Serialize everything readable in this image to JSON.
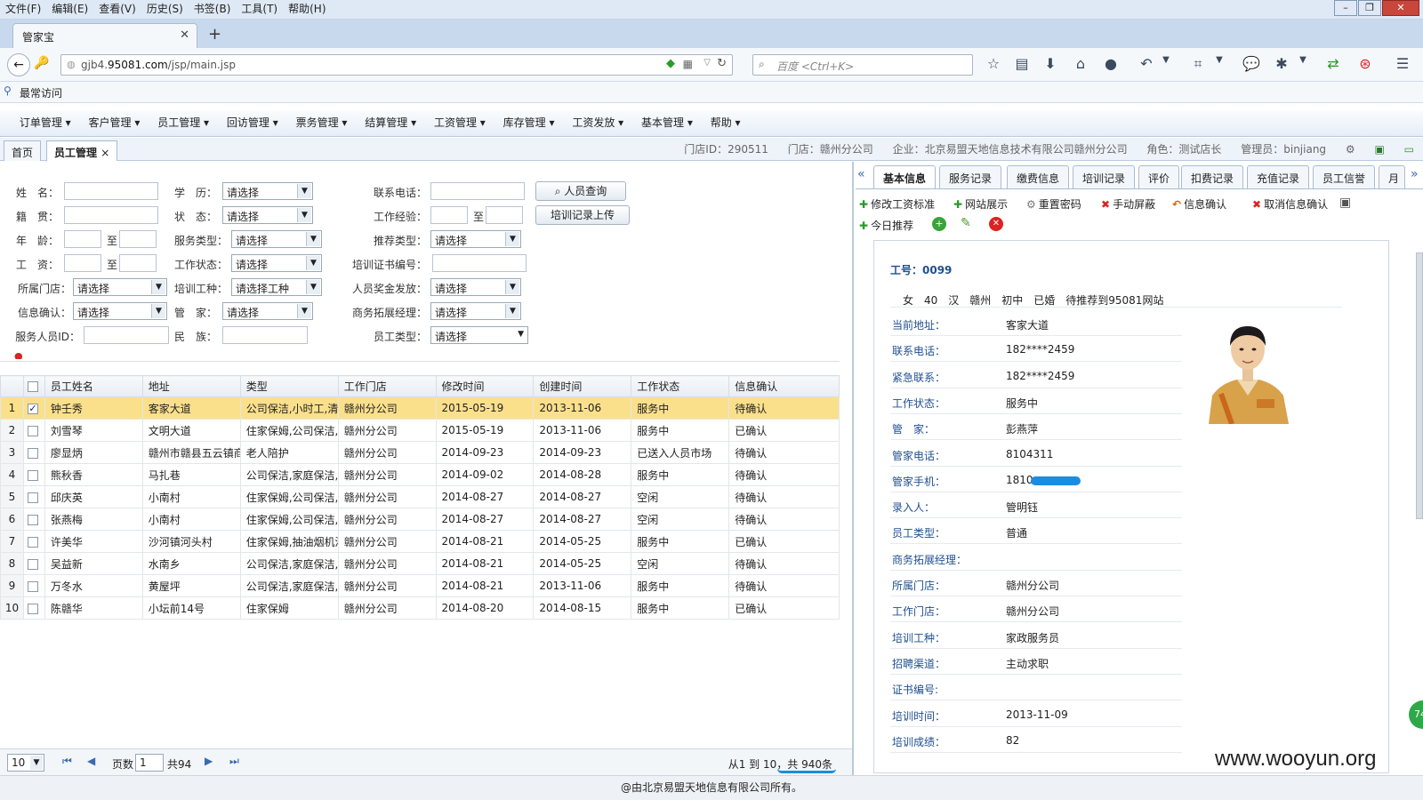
{
  "browser": {
    "menu": [
      "文件(F)",
      "编辑(E)",
      "查看(V)",
      "历史(S)",
      "书签(B)",
      "工具(T)",
      "帮助(H)"
    ],
    "tab_title": "管家宝",
    "url_prefix": "gjb4.",
    "url_domain": "95081.com",
    "url_path": "/jsp/main.jsp",
    "search_placeholder": "百度 <Ctrl+K>",
    "bookmark": "最常访问"
  },
  "app": {
    "menu": [
      "订单管理",
      "客户管理",
      "员工管理",
      "回访管理",
      "票务管理",
      "结算管理",
      "工资管理",
      "库存管理",
      "工资发放",
      "基本管理",
      "帮助"
    ],
    "tabs": [
      "首页",
      "员工管理"
    ],
    "info": {
      "store_id": "门店ID：290511",
      "store": "门店：赣州分公司",
      "company": "企业：北京易盟天地信息技术有限公司赣州分公司",
      "role": "角色：测试店长",
      "admin": "管理员：binjiang"
    }
  },
  "form": {
    "name": "姓　名：",
    "origin": "籍　贯：",
    "age": "年　龄：",
    "wage": "工　资：",
    "store": "所属门店：",
    "confirm": "信息确认：",
    "staff_id": "服务人员ID：",
    "edu": "学　历：",
    "status": "状　态：",
    "service_type": "服务类型：",
    "work_status": "工作状态：",
    "train_type": "培训工种：",
    "butler": "管　家：",
    "ethnic": "民　族：",
    "phone": "联系电话：",
    "experience": "工作经验：",
    "recommend": "推荐类型：",
    "cert_no": "培训证书编号：",
    "bonus": "人员奖金发放：",
    "biz_mgr": "商务拓展经理：",
    "emp_type": "员工类型：",
    "to": "至",
    "please_select": "请选择",
    "select_train": "请选择工种",
    "search_btn": "人员查询",
    "upload_btn": "培训记录上传"
  },
  "grid": {
    "columns": [
      "员工姓名",
      "地址",
      "类型",
      "工作门店",
      "修改时间",
      "创建时间",
      "工作状态",
      "信息确认"
    ],
    "rows": [
      {
        "no": "1",
        "name": "钟壬秀",
        "addr": "客家大道",
        "type": "公司保洁,小时工,清",
        "store": "赣州分公司",
        "mod": "2015-05-19",
        "created": "2013-11-06",
        "status": "服务中",
        "confirm": "待确认"
      },
      {
        "no": "2",
        "name": "刘雪琴",
        "addr": "文明大道",
        "type": "住家保姆,公司保洁,",
        "store": "赣州分公司",
        "mod": "2015-05-19",
        "created": "2013-11-06",
        "status": "服务中",
        "confirm": "已确认"
      },
      {
        "no": "3",
        "name": "廖显炳",
        "addr": "赣州市赣县五云镇商",
        "type": "老人陪护",
        "store": "赣州分公司",
        "mod": "2014-09-23",
        "created": "2014-09-23",
        "status": "已送入人员市场",
        "confirm": "待确认"
      },
      {
        "no": "4",
        "name": "熊秋香",
        "addr": "马扎巷",
        "type": "公司保洁,家庭保洁,",
        "store": "赣州分公司",
        "mod": "2014-09-02",
        "created": "2014-08-28",
        "status": "服务中",
        "confirm": "待确认"
      },
      {
        "no": "5",
        "name": "邱庆英",
        "addr": "小南村",
        "type": "住家保姆,公司保洁,",
        "store": "赣州分公司",
        "mod": "2014-08-27",
        "created": "2014-08-27",
        "status": "空闲",
        "confirm": "待确认"
      },
      {
        "no": "6",
        "name": "张燕梅",
        "addr": "小南村",
        "type": "住家保姆,公司保洁,",
        "store": "赣州分公司",
        "mod": "2014-08-27",
        "created": "2014-08-27",
        "status": "空闲",
        "confirm": "待确认"
      },
      {
        "no": "7",
        "name": "许美华",
        "addr": "沙河镇河头村",
        "type": "住家保姆,抽油烟机清",
        "store": "赣州分公司",
        "mod": "2014-08-21",
        "created": "2014-05-25",
        "status": "服务中",
        "confirm": "已确认"
      },
      {
        "no": "8",
        "name": "吴益新",
        "addr": "水南乡",
        "type": "公司保洁,家庭保洁,",
        "store": "赣州分公司",
        "mod": "2014-08-21",
        "created": "2014-05-25",
        "status": "空闲",
        "confirm": "待确认"
      },
      {
        "no": "9",
        "name": "万冬水",
        "addr": "黄屋坪",
        "type": "公司保洁,家庭保洁,",
        "store": "赣州分公司",
        "mod": "2014-08-21",
        "created": "2013-11-06",
        "status": "服务中",
        "confirm": "待确认"
      },
      {
        "no": "10",
        "name": "陈赣华",
        "addr": "小坛前14号",
        "type": "住家保姆",
        "store": "赣州分公司",
        "mod": "2014-08-20",
        "created": "2014-08-15",
        "status": "服务中",
        "confirm": "已确认"
      }
    ]
  },
  "pager": {
    "page_size": "10",
    "page_label": "页数",
    "page": "1",
    "total_pages": "共94",
    "summary": "从1 到 10，共 940条"
  },
  "detail": {
    "tabs": [
      "基本信息",
      "服务记录",
      "缴费信息",
      "培训记录",
      "评价",
      "扣费记录",
      "充值记录",
      "员工信誉",
      "月"
    ],
    "actions": [
      "修改工资标准",
      "网站展示",
      "重置密码",
      "手动屏蔽",
      "信息确认",
      "取消信息确认"
    ],
    "today_recommend": "今日推荐",
    "emp_no": "工号：0099",
    "summary": "女　40　汉　赣州　初中　已婚　待推荐到95081网站",
    "fields": [
      {
        "label": "当前地址：",
        "value": "客家大道"
      },
      {
        "label": "联系电话：",
        "value": "182****2459"
      },
      {
        "label": "紧急联系：",
        "value": "182****2459"
      },
      {
        "label": "工作状态：",
        "value": "服务中"
      },
      {
        "label": "管　家：",
        "value": "彭燕萍"
      },
      {
        "label": "管家电话：",
        "value": "8104311"
      },
      {
        "label": "管家手机：",
        "value": "1810"
      },
      {
        "label": "录入人：",
        "value": "管明钰"
      },
      {
        "label": "员工类型：",
        "value": "普通"
      },
      {
        "label": "商务拓展经理：",
        "value": ""
      },
      {
        "label": "所属门店：",
        "value": "赣州分公司"
      },
      {
        "label": "工作门店：",
        "value": "赣州分公司"
      },
      {
        "label": "培训工种：",
        "value": "家政服务员"
      },
      {
        "label": "招聘渠道：",
        "value": "主动求职"
      },
      {
        "label": "证书编号:",
        "value": ""
      },
      {
        "label": "培训时间：",
        "value": "2013-11-09"
      },
      {
        "label": "培训成绩：",
        "value": "82"
      }
    ]
  },
  "footer": "@由北京易盟天地信息有限公司所有。",
  "watermark": "www.wooyun.org",
  "badge": "74"
}
